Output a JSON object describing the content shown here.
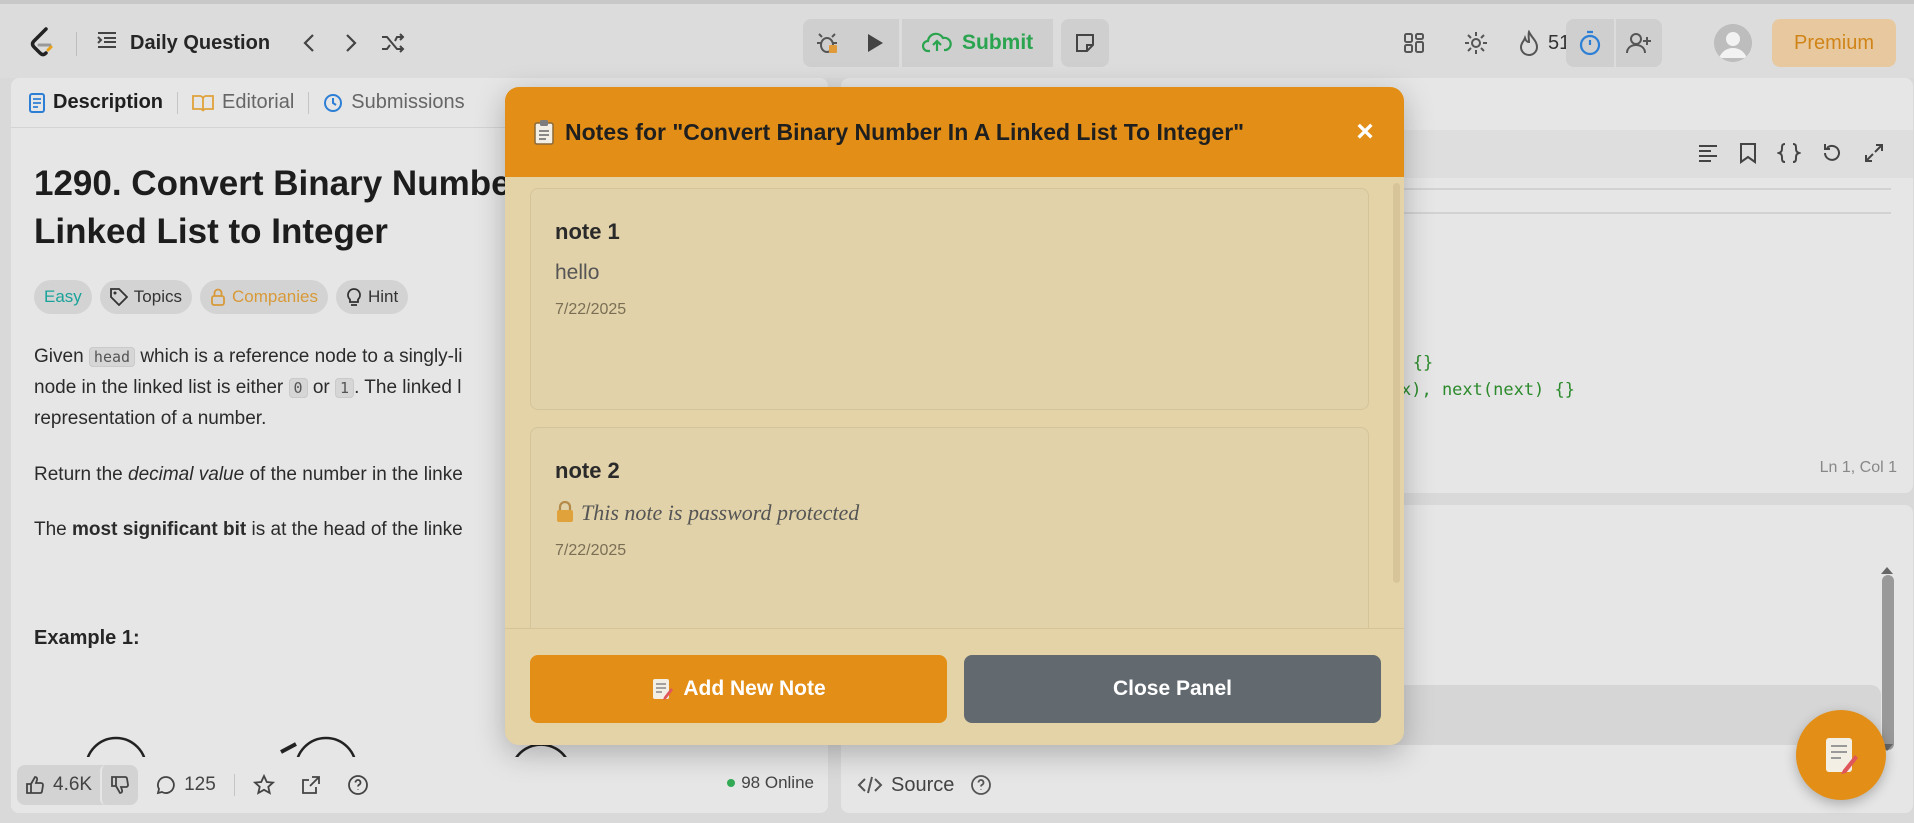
{
  "header": {
    "daily_label": "Daily Question",
    "submit_label": "Submit",
    "streak_count": "51",
    "premium_label": "Premium"
  },
  "problem": {
    "tabs": [
      {
        "label": "Description"
      },
      {
        "label": "Editorial"
      },
      {
        "label": "Submissions"
      }
    ],
    "title": "1290. Convert Binary Number in a Linked List to Integer",
    "title_line1": "1290. Convert Binary Numbe",
    "title_line2": "Linked List to Integer",
    "chips": {
      "easy": "Easy",
      "topics": "Topics",
      "companies": "Companies",
      "hint": "Hint"
    },
    "desc": {
      "p1_a": "Given ",
      "p1_code": "head",
      "p1_b": " which is a reference node to a singly-li",
      "p2_a": "node in the linked list is either ",
      "p2_code1": "0",
      "p2_or": " or ",
      "p2_code2": "1",
      "p2_b": ". The linked l",
      "p3": "representation of a number.",
      "p4_a": "Return the ",
      "p4_em": "decimal value",
      "p4_b": " of the number in the linke",
      "p5_a": "The ",
      "p5_strong": "most significant bit",
      "p5_b": " is at the head of the linke"
    },
    "example_label": "Example 1:",
    "footer": {
      "likes": "4.6K",
      "comments": "125",
      "online": "98 Online"
    }
  },
  "editor": {
    "code_line_1": "·) {}",
    "code_line_2": "x), next(next) {}",
    "cursor_pos": "Ln 1, Col 1",
    "source_label": "Source"
  },
  "notes_modal": {
    "title": "Notes for \"Convert Binary Number In A Linked List To Integer\"",
    "close_symbol": "×",
    "notes": [
      {
        "title": "note 1",
        "content": "hello",
        "date": "7/22/2025"
      },
      {
        "title": "note 2",
        "content": "This note is password protected",
        "date": "7/22/2025"
      }
    ],
    "add_label": "Add New Note",
    "close_label": "Close Panel"
  },
  "colors": {
    "accent_orange": "#e38f17",
    "modal_bg": "#e5d3a8",
    "close_btn": "#626a70",
    "submit_green": "#2aa44f"
  }
}
